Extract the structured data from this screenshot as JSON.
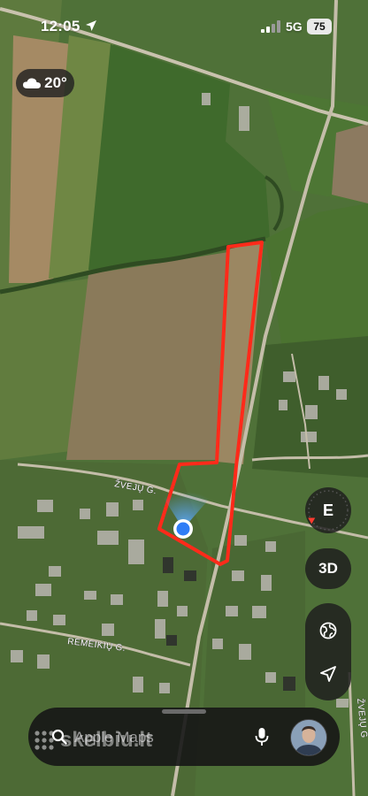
{
  "status_bar": {
    "time": "12:05",
    "network": "5G",
    "battery": "75"
  },
  "weather": {
    "temperature": "20°",
    "icon": "cloud-icon"
  },
  "map": {
    "road_labels": [
      "ŽVEJŲ G.",
      "REMEIKIŲ G.",
      "ŽVEJŲ G"
    ],
    "parcel_color": "#ff2a1a",
    "location_dot_color": "#2f7df6"
  },
  "controls": {
    "compass_direction": "E",
    "view_3d_label": "3D",
    "icons": [
      "globe-icon",
      "location-arrow-icon"
    ]
  },
  "search": {
    "placeholder": "Apple Maps"
  },
  "watermark": {
    "text": "skelbiu.lt"
  }
}
